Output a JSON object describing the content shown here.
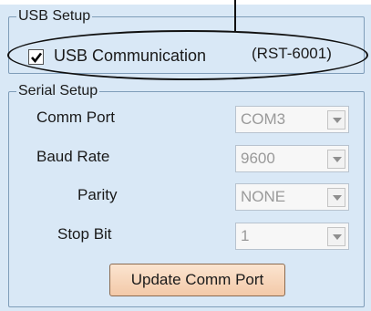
{
  "usb_setup": {
    "title": "USB Setup",
    "usb_communication": {
      "label": "USB Communication",
      "checked": true
    },
    "model": "(RST-6001)"
  },
  "serial_setup": {
    "title": "Serial Setup",
    "comm_port": {
      "label": "Comm Port",
      "value": "COM3"
    },
    "baud_rate": {
      "label": "Baud Rate",
      "value": "9600"
    },
    "parity": {
      "label": "Parity",
      "value": "NONE"
    },
    "stop_bit": {
      "label": "Stop Bit",
      "value": "1"
    },
    "update_button": "Update Comm Port"
  },
  "icons": {
    "check": "checkmark-icon",
    "dropdown": "chevron-down-icon"
  },
  "colors": {
    "panel_bg": "#d9e8f6",
    "button_bg": "#f3c9a8",
    "disabled_text": "#9a9a9a"
  }
}
